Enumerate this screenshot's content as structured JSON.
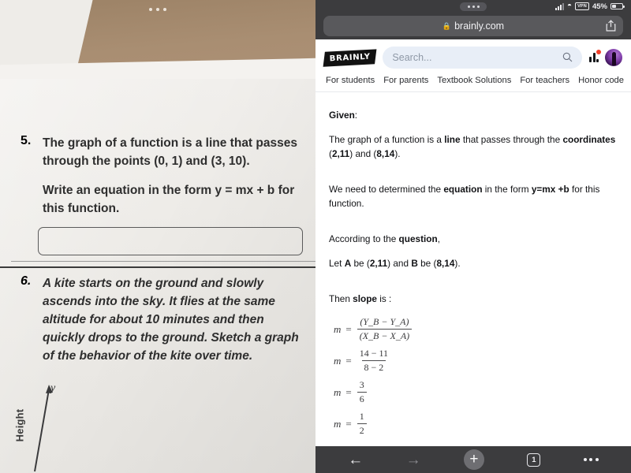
{
  "left_photo": {
    "drag_handle": "drag-handle-dots",
    "questions": [
      {
        "number": "5.",
        "paragraphs": [
          "The graph of a function is a line that passes through the points (0, 1) and (3, 10).",
          "Write an equation in the form y = mx + b for this function."
        ]
      },
      {
        "number": "6.",
        "paragraphs": [
          "A kite starts on the ground and slowly ascends into the sky. It flies at the same altitude for about 10 minutes and then quickly drops to the ground. Sketch a graph of the behavior of the kite over time."
        ]
      }
    ],
    "graph": {
      "y_axis_label": "y",
      "axis_title": "Height"
    }
  },
  "browser": {
    "status_bar": {
      "battery_percent": "45%",
      "vpn_badge": "VPN"
    },
    "address_bar": {
      "url": "brainly.com",
      "lock": "🔒"
    },
    "toolbar": {
      "back": "←",
      "forward": "→",
      "new_tab": "+",
      "tab_count": "1",
      "more": "•••"
    }
  },
  "site": {
    "logo": "BRAINLY",
    "search": {
      "placeholder": "Search..."
    },
    "nav": [
      {
        "label": "For students"
      },
      {
        "label": "For parents"
      },
      {
        "label": "Textbook Solutions"
      },
      {
        "label": "For teachers"
      },
      {
        "label": "Honor code"
      }
    ],
    "answer": {
      "given_label": "Given",
      "given_colon": ":",
      "line1_a": "The graph of a function is a ",
      "line1_b": "line",
      "line1_c": " that passes through the ",
      "line2_a": "coordinates",
      "line2_b": " (",
      "line2_c": "2,11",
      "line2_d": ") and (",
      "line2_e": "8,14",
      "line2_f": ").",
      "need_a": "We need to determined the ",
      "need_b": "equation",
      "need_c": " in the form ",
      "need_d": "y=mx +b",
      "need_e": " for this function.",
      "according_a": "According to the ",
      "according_b": "question",
      "according_c": ",",
      "let_a": "Let  ",
      "let_b": "A",
      "let_c": "  be (",
      "let_d": "2,11",
      "let_e": ") and ",
      "let_f": "B",
      "let_g": " be (",
      "let_h": "8,14",
      "let_i": ").",
      "slope_a": "Then ",
      "slope_b": "slope",
      "slope_c": " is :",
      "equations": [
        {
          "lhs": "m",
          "eq": "=",
          "num": "(Y_B − Y_A)",
          "den": "(X_B − X_A)"
        },
        {
          "lhs": "m",
          "eq": "=",
          "num": "14 − 11",
          "den": "8 − 2"
        },
        {
          "lhs": "m",
          "eq": "=",
          "num": "3",
          "den": "6"
        },
        {
          "lhs": "m",
          "eq": "=",
          "num": "1",
          "den": "2"
        }
      ]
    }
  },
  "colors": {
    "chrome": "#3c3c3e",
    "search_bg": "#e8eef7",
    "notification": "#f2402a",
    "paper": "#f1efec"
  }
}
